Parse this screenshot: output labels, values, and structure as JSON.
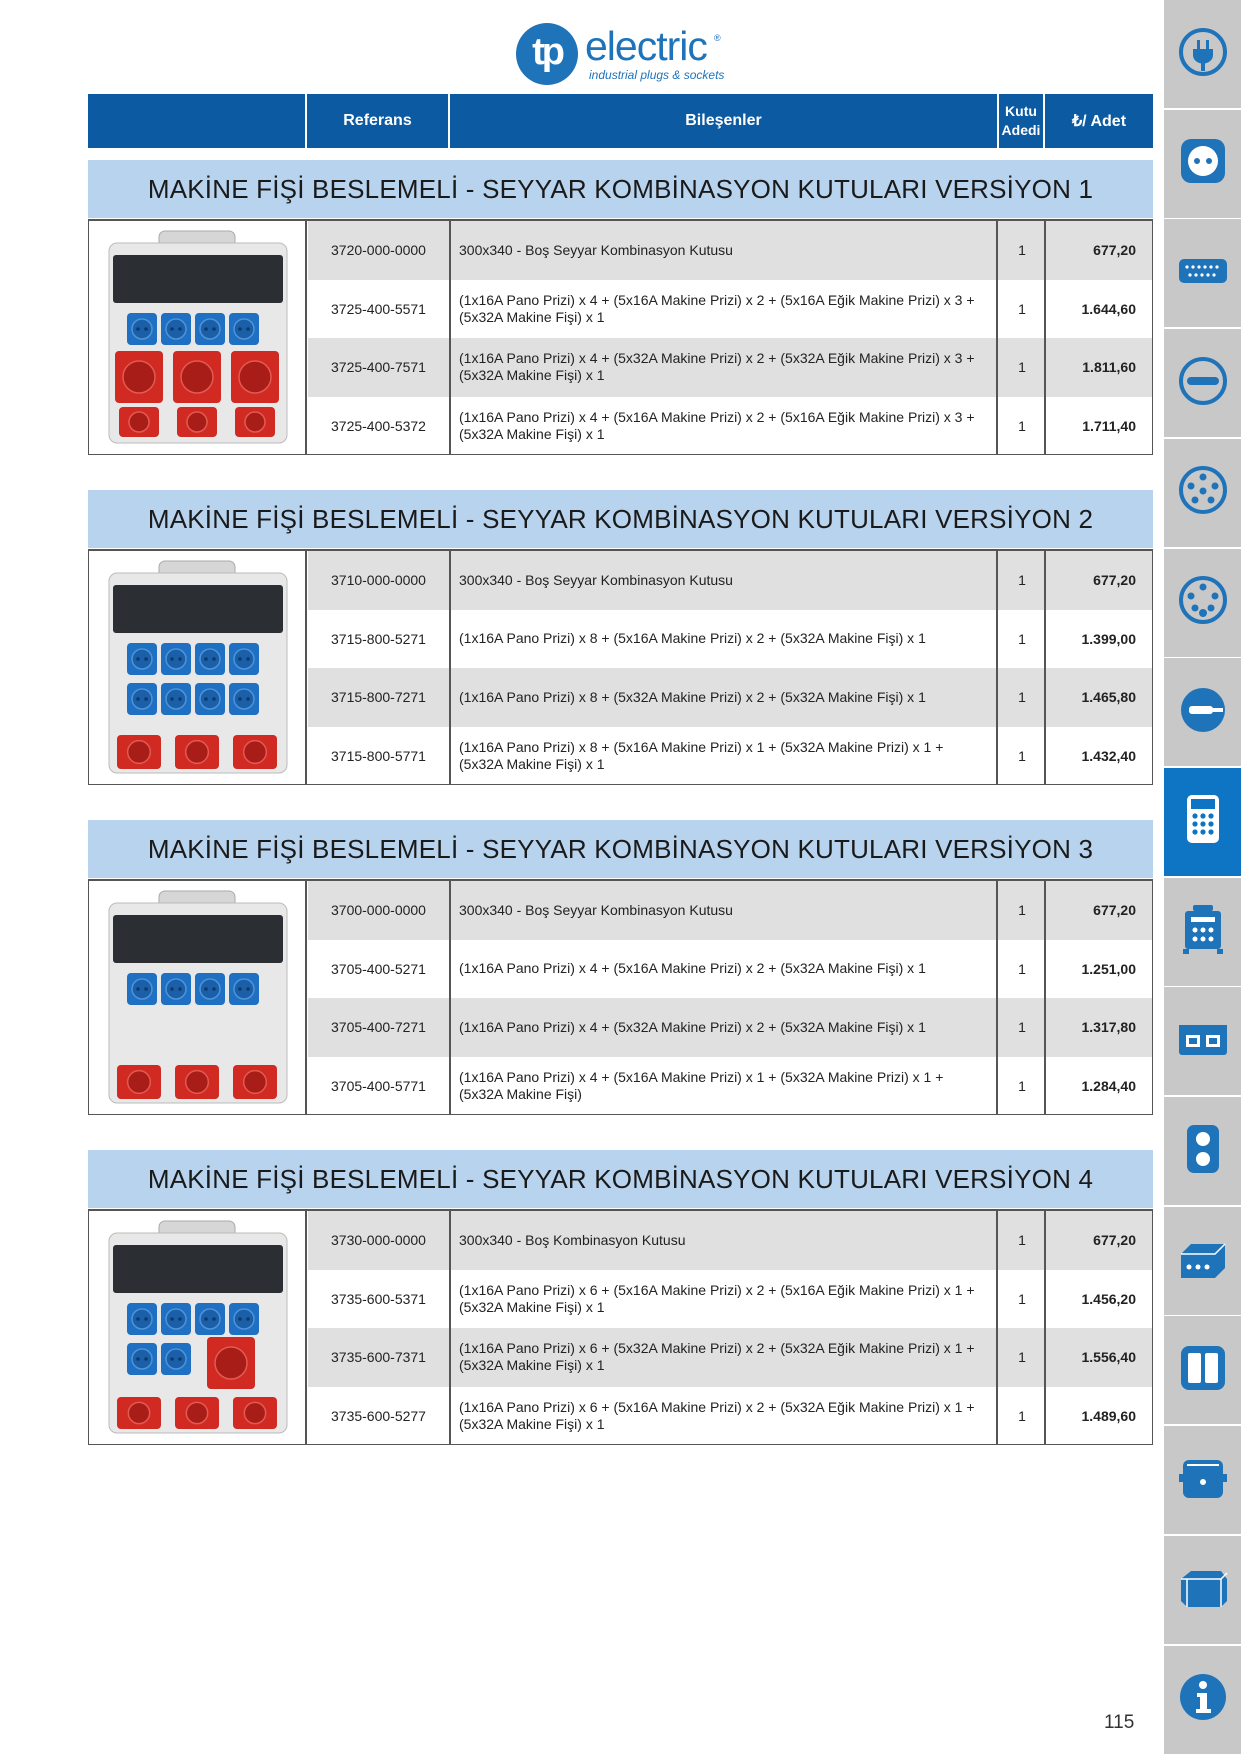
{
  "brand": {
    "mark": "tp",
    "word": "electric",
    "reg": "®",
    "tagline": "industrial plugs & sockets",
    "color": "#1f73b9"
  },
  "header": {
    "ref": "Referans",
    "components": "Bileşenler",
    "box_qty_1": "Kutu",
    "box_qty_2": "Adedi",
    "price": "₺/ Adet"
  },
  "sections": [
    {
      "title": "MAKİNE FİŞİ BESLEMELİ - SEYYAR KOMBİNASYON KUTULARI VERSİYON 1",
      "image": "combination-box-v1",
      "rows": [
        {
          "ref": "3720-000-0000",
          "desc": "300x340 - Boş Seyyar Kombinasyon Kutusu",
          "qty": "1",
          "price": "677,20"
        },
        {
          "ref": "3725-400-5571",
          "desc": "(1x16A Pano Prizi) x 4 + (5x16A Makine Prizi) x 2 + (5x16A Eğik Makine Prizi) x 3 + (5x32A Makine Fişi) x 1",
          "qty": "1",
          "price": "1.644,60"
        },
        {
          "ref": "3725-400-7571",
          "desc": "(1x16A Pano Prizi) x 4 + (5x32A Makine Prizi) x 2 + (5x32A Eğik Makine Prizi) x 3 + (5x32A Makine Fişi) x 1",
          "qty": "1",
          "price": "1.811,60"
        },
        {
          "ref": "3725-400-5372",
          "desc": "(1x16A Pano Prizi) x 4 + (5x16A Makine Prizi) x 2 + (5x16A Eğik Makine Prizi) x 3 + (5x32A Makine Fişi) x 1",
          "qty": "1",
          "price": "1.711,40"
        }
      ]
    },
    {
      "title": "MAKİNE FİŞİ BESLEMELİ - SEYYAR KOMBİNASYON KUTULARI VERSİYON 2",
      "image": "combination-box-v2",
      "rows": [
        {
          "ref": "3710-000-0000",
          "desc": "300x340 - Boş Seyyar Kombinasyon Kutusu",
          "qty": "1",
          "price": "677,20"
        },
        {
          "ref": "3715-800-5271",
          "desc": "(1x16A Pano Prizi) x 8 + (5x16A Makine Prizi) x 2 + (5x32A Makine Fişi) x 1",
          "qty": "1",
          "price": "1.399,00"
        },
        {
          "ref": "3715-800-7271",
          "desc": "(1x16A Pano Prizi) x 8 + (5x32A Makine Prizi) x 2 + (5x32A Makine Fişi) x 1",
          "qty": "1",
          "price": "1.465,80"
        },
        {
          "ref": "3715-800-5771",
          "desc": "(1x16A Pano Prizi) x 8 + (5x16A Makine Prizi) x 1 + (5x32A Makine Prizi) x 1 + (5x32A Makine Fişi) x 1",
          "qty": "1",
          "price": "1.432,40"
        }
      ]
    },
    {
      "title": "MAKİNE FİŞİ BESLEMELİ - SEYYAR KOMBİNASYON KUTULARI VERSİYON 3",
      "image": "combination-box-v3",
      "rows": [
        {
          "ref": "3700-000-0000",
          "desc": "300x340 - Boş Seyyar Kombinasyon Kutusu",
          "qty": "1",
          "price": "677,20"
        },
        {
          "ref": "3705-400-5271",
          "desc": "(1x16A Pano Prizi) x 4 + (5x16A Makine Prizi) x 2 + (5x32A Makine Fişi) x 1",
          "qty": "1",
          "price": "1.251,00"
        },
        {
          "ref": "3705-400-7271",
          "desc": "(1x16A Pano Prizi) x 4 + (5x32A Makine Prizi) x 2 + (5x32A Makine Fişi) x 1",
          "qty": "1",
          "price": "1.317,80"
        },
        {
          "ref": "3705-400-5771",
          "desc": "(1x16A Pano Prizi) x 4 + (5x16A Makine Prizi) x 1 + (5x32A Makine Prizi) x 1 + (5x32A Makine Fişi)",
          "qty": "1",
          "price": "1.284,40"
        }
      ]
    },
    {
      "title": "MAKİNE FİŞİ BESLEMELİ - SEYYAR KOMBİNASYON KUTULARI VERSİYON 4",
      "image": "combination-box-v4",
      "rows": [
        {
          "ref": "3730-000-0000",
          "desc": "300x340 - Boş Kombinasyon Kutusu",
          "qty": "1",
          "price": "677,20"
        },
        {
          "ref": "3735-600-5371",
          "desc": "(1x16A Pano Prizi) x 6 + (5x16A Makine Prizi) x 2 + (5x16A Eğik Makine Prizi) x 1 + (5x32A Makine Fişi) x 1",
          "qty": "1",
          "price": "1.456,20"
        },
        {
          "ref": "3735-600-7371",
          "desc": "(1x16A Pano Prizi) x 6 + (5x32A Makine Prizi) x 2 + (5x32A Eğik Makine Prizi) x 1 + (5x32A Makine Fişi) x 1",
          "qty": "1",
          "price": "1.556,40"
        },
        {
          "ref": "3735-600-5277",
          "desc": "(1x16A Pano Prizi) x 6 + (5x16A Makine Prizi) x 2 + (5x32A Eğik Makine Prizi) x 1 + (5x32A Makine Fişi) x 1",
          "qty": "1",
          "price": "1.489,60"
        }
      ]
    }
  ],
  "sidebar": {
    "tabs": [
      {
        "icon": "plug-icon"
      },
      {
        "icon": "socket-icon"
      },
      {
        "icon": "multi-pin-connector-icon"
      },
      {
        "icon": "round-connector-icon"
      },
      {
        "icon": "five-pin-socket-icon"
      },
      {
        "icon": "socket-with-indicator-icon"
      },
      {
        "icon": "inlet-plug-icon"
      },
      {
        "icon": "combination-box-icon",
        "active": true
      },
      {
        "icon": "distribution-box-icon"
      },
      {
        "icon": "panel-box-icon"
      },
      {
        "icon": "dual-socket-icon"
      },
      {
        "icon": "junction-box-icon"
      },
      {
        "icon": "double-panel-icon"
      },
      {
        "icon": "enclosure-icon"
      },
      {
        "icon": "box-3d-icon"
      },
      {
        "icon": "info-icon"
      }
    ],
    "active_color": "#0e74c4",
    "inactive_color": "#c8c8c8"
  },
  "page_number": "115"
}
